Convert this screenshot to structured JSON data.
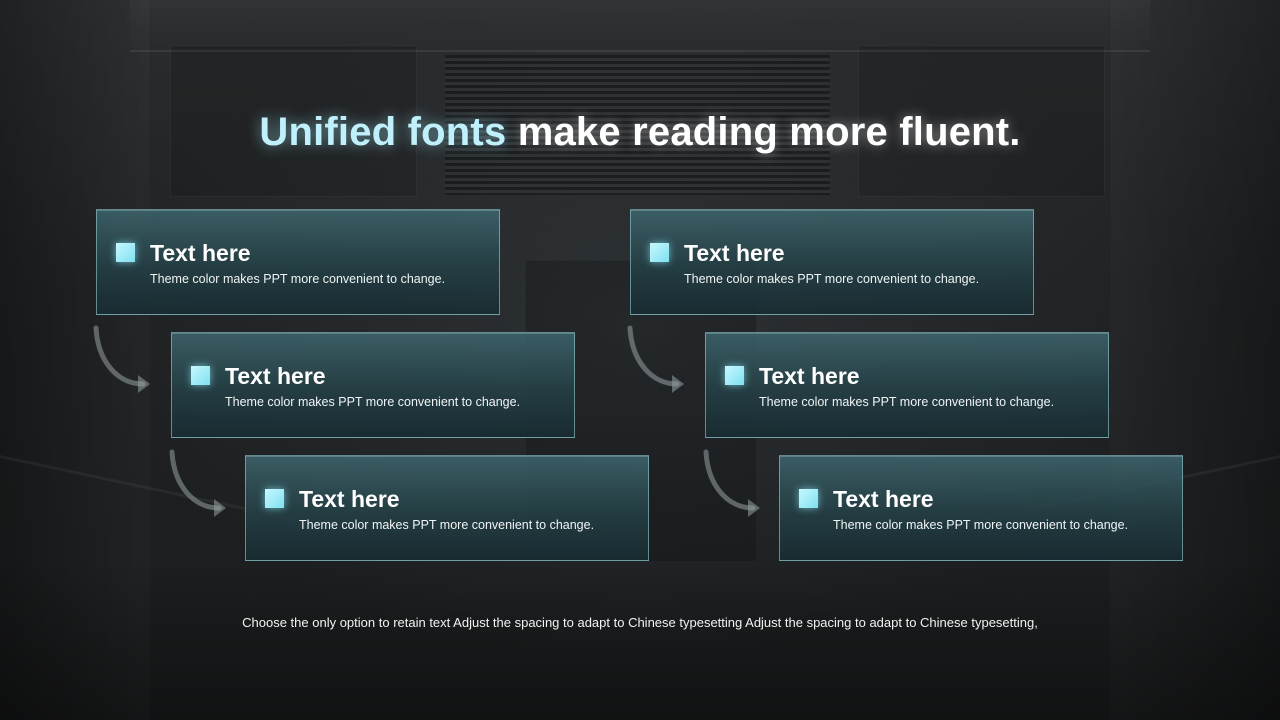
{
  "title": {
    "accent": "Unified fonts",
    "rest": " make reading more fluent."
  },
  "colors": {
    "accent": "#bff0fb",
    "bullet": "#9eeaf6",
    "card_border": "#a0d7dc",
    "card_fill": "#2c4e55"
  },
  "icons": {
    "bullet": "square-bullet-icon",
    "connector": "curved-arrow-icon"
  },
  "left_column": [
    {
      "heading": "Text here",
      "description": "Theme color makes PPT more convenient  to change."
    },
    {
      "heading": "Text here",
      "description": "Theme color makes PPT more convenient  to change."
    },
    {
      "heading": "Text here",
      "description": "Theme color makes PPT more convenient  to change."
    }
  ],
  "right_column": [
    {
      "heading": "Text here",
      "description": "Theme color makes PPT more convenient  to change."
    },
    {
      "heading": "Text here",
      "description": "Theme color makes PPT more convenient  to change."
    },
    {
      "heading": "Text here",
      "description": "Theme color makes PPT more convenient  to change."
    }
  ],
  "footer": "Choose the only option to retain text Adjust the spacing to adapt to Chinese  typesetting Adjust the spacing to adapt to Chinese typesetting,"
}
